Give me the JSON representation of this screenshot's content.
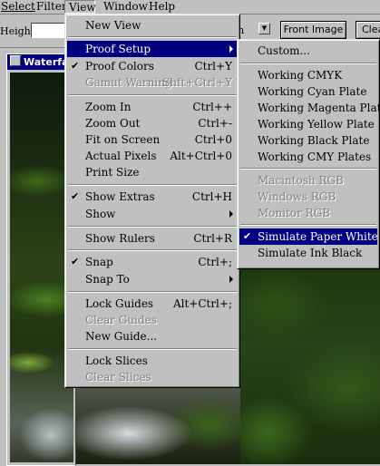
{
  "menubar": {
    "items": [
      {
        "label": "Select",
        "key": "select"
      },
      {
        "label": "Filter",
        "key": "filter"
      },
      {
        "label": "View",
        "key": "view"
      },
      {
        "label": "Window",
        "key": "window"
      },
      {
        "label": "Help",
        "key": "help"
      }
    ]
  },
  "options": {
    "height_label": "Height:",
    "resolution_unit": "ch",
    "front_image_label": "Front Image",
    "clear_label": "Clea"
  },
  "document": {
    "title": "Waterfall"
  },
  "view_menu": {
    "items": [
      {
        "label": "New View"
      },
      {
        "label": "Proof Setup",
        "highlighted": true
      },
      {
        "label": "Proof Colors",
        "shortcut": "Ctrl+Y",
        "checked": true
      },
      {
        "label": "Gamut Warning",
        "shortcut": "Shft+Ctrl+Y",
        "disabled": true
      },
      {
        "label": "Zoom In",
        "shortcut": "Ctrl++"
      },
      {
        "label": "Zoom Out",
        "shortcut": "Ctrl+-"
      },
      {
        "label": "Fit on Screen",
        "shortcut": "Ctrl+0"
      },
      {
        "label": "Actual Pixels",
        "shortcut": "Alt+Ctrl+0"
      },
      {
        "label": "Print Size"
      },
      {
        "label": "Show Extras",
        "shortcut": "Ctrl+H",
        "checked": true
      },
      {
        "label": "Show"
      },
      {
        "label": "Show Rulers",
        "shortcut": "Ctrl+R"
      },
      {
        "label": "Snap",
        "shortcut": "Ctrl+;",
        "checked": true
      },
      {
        "label": "Snap To"
      },
      {
        "label": "Lock Guides",
        "shortcut": "Alt+Ctrl+;"
      },
      {
        "label": "Clear Guides",
        "disabled": true
      },
      {
        "label": "New Guide..."
      },
      {
        "label": "Lock Slices"
      },
      {
        "label": "Clear Slices",
        "disabled": true
      }
    ]
  },
  "proof_menu": {
    "items": [
      {
        "label": "Custom..."
      },
      {
        "label": "Working CMYK"
      },
      {
        "label": "Working Cyan Plate"
      },
      {
        "label": "Working Magenta Plate"
      },
      {
        "label": "Working Yellow Plate"
      },
      {
        "label": "Working Black Plate"
      },
      {
        "label": "Working CMY Plates"
      },
      {
        "label": "Macintosh RGB",
        "disabled": true
      },
      {
        "label": "Windows RGB",
        "disabled": true
      },
      {
        "label": "Monitor RGB",
        "disabled": true
      },
      {
        "label": "Simulate Paper White",
        "checked": true,
        "highlighted": true
      },
      {
        "label": "Simulate Ink Black"
      }
    ]
  },
  "icons": {
    "check": "✔",
    "dropdown": "▼"
  }
}
